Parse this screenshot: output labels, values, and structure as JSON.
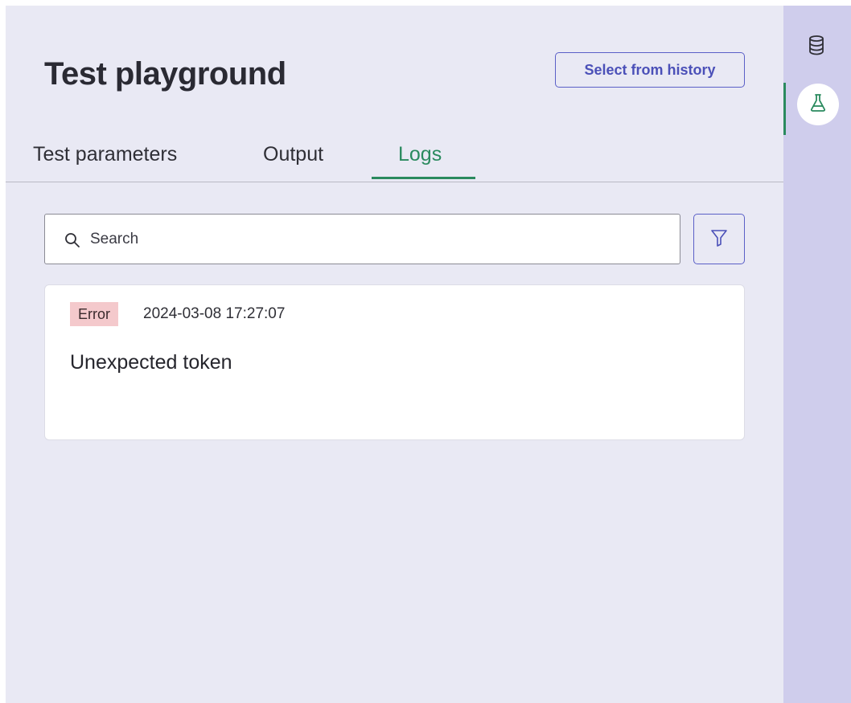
{
  "header": {
    "title": "Test playground",
    "history_button_label": "Select from history"
  },
  "tabs": [
    {
      "label": "Test parameters",
      "active": false
    },
    {
      "label": "Output",
      "active": false
    },
    {
      "label": "Logs",
      "active": true
    }
  ],
  "search": {
    "placeholder": "Search",
    "value": ""
  },
  "logs": [
    {
      "level": "Error",
      "timestamp": "2024-03-08 17:27:07",
      "message": "Unexpected token"
    }
  ],
  "icons": {
    "search": "search-icon",
    "filter": "filter-icon",
    "database": "database-icon",
    "flask": "flask-icon"
  },
  "colors": {
    "accent_green": "#2a8a5e",
    "accent_indigo": "#5a5fc7",
    "panel_bg": "#e9e9f4",
    "rail_bg": "#cfcdec",
    "error_badge_bg": "#f4c9cc"
  }
}
